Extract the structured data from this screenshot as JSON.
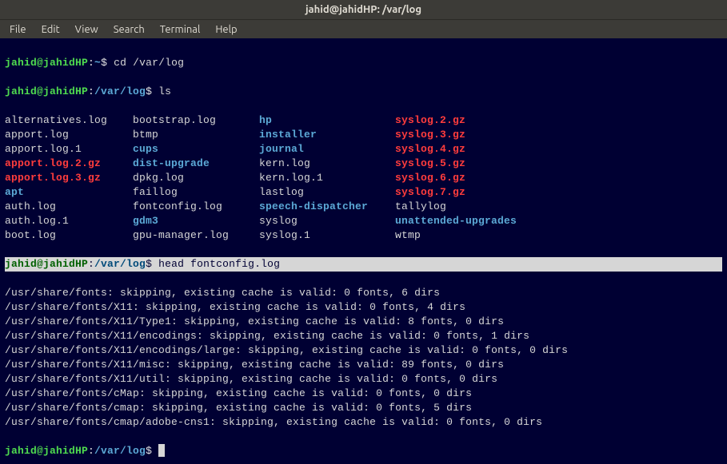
{
  "titlebar": "jahid@jahidHP: /var/log",
  "menu": {
    "file": "File",
    "edit": "Edit",
    "view": "View",
    "search": "Search",
    "terminal": "Terminal",
    "help": "Help"
  },
  "prompt": {
    "userhost": "jahid@jahidHP",
    "home": "~",
    "path": "/var/log",
    "sep": ":",
    "dollar": "$"
  },
  "cmd": {
    "cd": "cd /var/log",
    "ls": "ls",
    "head": "head fontconfig.log"
  },
  "ls": [
    [
      {
        "t": "alternatives.log",
        "c": ""
      },
      {
        "t": "bootstrap.log",
        "c": ""
      },
      {
        "t": "hp",
        "c": "blue"
      },
      {
        "t": "syslog.2.gz",
        "c": "red"
      }
    ],
    [
      {
        "t": "apport.log",
        "c": ""
      },
      {
        "t": "btmp",
        "c": ""
      },
      {
        "t": "installer",
        "c": "blue"
      },
      {
        "t": "syslog.3.gz",
        "c": "red"
      }
    ],
    [
      {
        "t": "apport.log.1",
        "c": ""
      },
      {
        "t": "cups",
        "c": "blue"
      },
      {
        "t": "journal",
        "c": "blue"
      },
      {
        "t": "syslog.4.gz",
        "c": "red"
      }
    ],
    [
      {
        "t": "apport.log.2.gz",
        "c": "red"
      },
      {
        "t": "dist-upgrade",
        "c": "blue"
      },
      {
        "t": "kern.log",
        "c": ""
      },
      {
        "t": "syslog.5.gz",
        "c": "red"
      }
    ],
    [
      {
        "t": "apport.log.3.gz",
        "c": "red"
      },
      {
        "t": "dpkg.log",
        "c": ""
      },
      {
        "t": "kern.log.1",
        "c": ""
      },
      {
        "t": "syslog.6.gz",
        "c": "red"
      }
    ],
    [
      {
        "t": "apt",
        "c": "blue"
      },
      {
        "t": "faillog",
        "c": ""
      },
      {
        "t": "lastlog",
        "c": ""
      },
      {
        "t": "syslog.7.gz",
        "c": "red"
      }
    ],
    [
      {
        "t": "auth.log",
        "c": ""
      },
      {
        "t": "fontconfig.log",
        "c": ""
      },
      {
        "t": "speech-dispatcher",
        "c": "blue"
      },
      {
        "t": "tallylog",
        "c": ""
      }
    ],
    [
      {
        "t": "auth.log.1",
        "c": ""
      },
      {
        "t": "gdm3",
        "c": "blue"
      },
      {
        "t": "syslog",
        "c": ""
      },
      {
        "t": "unattended-upgrades",
        "c": "blue"
      }
    ],
    [
      {
        "t": "boot.log",
        "c": ""
      },
      {
        "t": "gpu-manager.log",
        "c": ""
      },
      {
        "t": "syslog.1",
        "c": ""
      },
      {
        "t": "wtmp",
        "c": ""
      }
    ]
  ],
  "out": [
    "/usr/share/fonts: skipping, existing cache is valid: 0 fonts, 6 dirs",
    "/usr/share/fonts/X11: skipping, existing cache is valid: 0 fonts, 4 dirs",
    "/usr/share/fonts/X11/Type1: skipping, existing cache is valid: 8 fonts, 0 dirs",
    "/usr/share/fonts/X11/encodings: skipping, existing cache is valid: 0 fonts, 1 dirs",
    "/usr/share/fonts/X11/encodings/large: skipping, existing cache is valid: 0 fonts, 0 dirs",
    "/usr/share/fonts/X11/misc: skipping, existing cache is valid: 89 fonts, 0 dirs",
    "/usr/share/fonts/X11/util: skipping, existing cache is valid: 0 fonts, 0 dirs",
    "/usr/share/fonts/cMap: skipping, existing cache is valid: 0 fonts, 0 dirs",
    "/usr/share/fonts/cmap: skipping, existing cache is valid: 0 fonts, 5 dirs",
    "/usr/share/fonts/cmap/adobe-cns1: skipping, existing cache is valid: 0 fonts, 0 dirs"
  ]
}
